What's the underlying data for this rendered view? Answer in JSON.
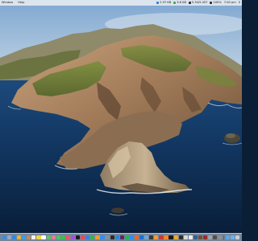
{
  "menubar": {
    "left_items": [
      "Window",
      "Help"
    ],
    "status_left": "2.97 KB",
    "status_cpu": "3.6 KB",
    "status_memory": "5.34/5.457",
    "status_misc": "100%",
    "status_clock": "7:00 pm",
    "status_right": "S"
  },
  "dock": {
    "icons": [
      {
        "name": "finder-icon",
        "color": "#3b8de0"
      },
      {
        "name": "launchpad-icon",
        "color": "#9aa6b8"
      },
      {
        "name": "safari-icon",
        "color": "#2f88e8"
      },
      {
        "name": "chrome-icon",
        "color": "#e8b33a"
      },
      {
        "name": "mail-icon",
        "color": "#3c9be8"
      },
      {
        "name": "contacts-icon",
        "color": "#b58d63"
      },
      {
        "name": "calendar-icon",
        "color": "#f2f2f2"
      },
      {
        "name": "notes-icon",
        "color": "#f4d443"
      },
      {
        "name": "reminders-icon",
        "color": "#ffffff"
      },
      {
        "name": "maps-icon",
        "color": "#5dbf6b"
      },
      {
        "name": "photos-icon",
        "color": "#e57b9b"
      },
      {
        "name": "messages-icon",
        "color": "#46c75a"
      },
      {
        "name": "facetime-icon",
        "color": "#3dbd50"
      },
      {
        "name": "music-icon",
        "color": "#f25067"
      },
      {
        "name": "podcasts-icon",
        "color": "#9c53d8"
      },
      {
        "name": "tv-icon",
        "color": "#1c1c1e"
      },
      {
        "name": "news-icon",
        "color": "#f0455a"
      },
      {
        "name": "keynote-icon",
        "color": "#3b7fe0"
      },
      {
        "name": "numbers-icon",
        "color": "#36b34a"
      },
      {
        "name": "pages-icon",
        "color": "#f39a30"
      },
      {
        "name": "app-store-icon",
        "color": "#2f8ff0"
      },
      {
        "name": "system-preferences-icon",
        "color": "#8a8e95"
      },
      {
        "name": "terminal-icon",
        "color": "#2b2b2b"
      },
      {
        "name": "vscode-icon",
        "color": "#2c86d6"
      },
      {
        "name": "slack-icon",
        "color": "#5b2a62"
      },
      {
        "name": "spotify-icon",
        "color": "#1db954"
      },
      {
        "name": "zoom-icon",
        "color": "#2d8cff"
      },
      {
        "name": "firefox-icon",
        "color": "#e66a2c"
      },
      {
        "name": "xcode-icon",
        "color": "#1e6fd9"
      },
      {
        "name": "preview-icon",
        "color": "#6ba7d8"
      },
      {
        "name": "activity-monitor-icon",
        "color": "#3a3a3a"
      },
      {
        "name": "calculator-icon",
        "color": "#f29b38"
      },
      {
        "name": "photo-booth-icon",
        "color": "#c63b3b"
      },
      {
        "name": "books-icon",
        "color": "#f2852c"
      },
      {
        "name": "stocks-icon",
        "color": "#1b1b1b"
      },
      {
        "name": "home-icon",
        "color": "#f5a623"
      },
      {
        "name": "voice-memos-icon",
        "color": "#2d2d2d"
      },
      {
        "name": "font-book-icon",
        "color": "#d9d9d9"
      },
      {
        "name": "textedit-icon",
        "color": "#e9e9e9"
      },
      {
        "name": "quicktime-icon",
        "color": "#3a5d8f"
      },
      {
        "name": "chess-icon",
        "color": "#6d5337"
      },
      {
        "name": "dictionary-icon",
        "color": "#9d2a2a"
      },
      {
        "name": "disk-utility-icon",
        "color": "#9ea3aa"
      },
      {
        "name": "console-icon",
        "color": "#505050"
      },
      {
        "name": "screenshot-icon",
        "color": "#8f8f8f"
      }
    ],
    "trailing_icons": [
      {
        "name": "downloads-folder-icon",
        "color": "#5aa6e8"
      },
      {
        "name": "documents-folder-icon",
        "color": "#6fb0ea"
      },
      {
        "name": "trash-icon",
        "color": "#c9ced6"
      }
    ]
  }
}
